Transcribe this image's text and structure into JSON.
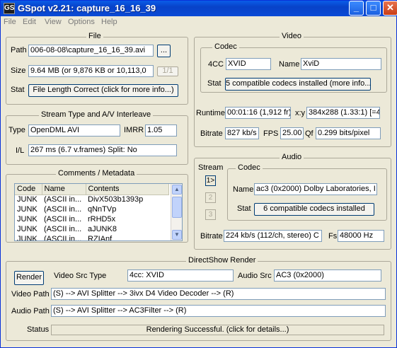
{
  "window": {
    "title": "GSpot v2.21: capture_16_16_39",
    "app_icon": "GS"
  },
  "menu": [
    "File",
    "Edit",
    "View",
    "Options",
    "Help"
  ],
  "file": {
    "group_title": "File",
    "path_label": "Path",
    "path_value": "006-08-08\\capture_16_16_39.avi",
    "browse_label": "...",
    "size_label": "Size",
    "size_value": "9.64 MB (or 9,876 KB or 10,113,0",
    "part_label": "1/1",
    "stat_label": "Stat",
    "stat_value": "File Length Correct (click for more info...)"
  },
  "stream": {
    "group_title": "Stream Type and A/V Interleave",
    "type_label": "Type",
    "type_value": "OpenDML AVI",
    "imrr_label": "IMRR",
    "imrr_value": "1.05",
    "il_label": "I/L",
    "il_value": "267 ms (6.7 v.frames)  Split: No"
  },
  "comments": {
    "group_title": "Comments / Metadata",
    "columns": [
      "Code",
      "Name",
      "Contents"
    ],
    "rows": [
      [
        "JUNK",
        "(ASCII in...",
        "DivX503b1393p"
      ],
      [
        "JUNK",
        "(ASCII in...",
        "qNnTVp"
      ],
      [
        "JUNK",
        "(ASCII in...",
        "rRHD5x"
      ],
      [
        "JUNK",
        "(ASCII in...",
        "aJUNK8"
      ],
      [
        "JUNK",
        "(ASCII in...",
        "RZIAnf"
      ]
    ]
  },
  "video": {
    "group_title": "Video",
    "codec_group": "Codec",
    "fourcc_label": "4CC",
    "fourcc_value": "XVID",
    "name_label": "Name",
    "name_value": "XviD",
    "stat_label": "Stat",
    "stat_value": "5 compatible codecs installed (more info...)",
    "runtime_label": "Runtime",
    "runtime_value": "00:01:16 (1,912 fr)",
    "xy_label": "x:y",
    "xy_value": "384x288 (1.33:1) [=4:",
    "bitrate_label": "Bitrate",
    "bitrate_value": "827 kb/s",
    "fps_label": "FPS",
    "fps_value": "25.00",
    "qf_label": "Qf",
    "qf_value": "0.299 bits/pixel"
  },
  "audio": {
    "group_title": "Audio",
    "stream_label": "Stream",
    "streams": [
      "1>",
      "2",
      "3"
    ],
    "codec_group": "Codec",
    "name_label": "Name",
    "name_value": "ac3 (0x2000) Dolby Laboratories, I",
    "stat_label": "Stat",
    "stat_value": "6 compatible codecs installed",
    "bitrate_label": "Bitrate",
    "bitrate_value": "224 kb/s (112/ch, stereo) C",
    "fs_label": "Fs",
    "fs_value": "48000 Hz"
  },
  "render": {
    "group_title": "DirectShow Render",
    "render_button": "Render",
    "vsrc_label": "Video Src Type",
    "vsrc_value": "4cc: XVID",
    "asrc_label": "Audio Src",
    "asrc_value": "AC3 (0x2000)",
    "vpath_label": "Video Path",
    "vpath_value": "(S) --> AVI Splitter --> 3ivx D4 Video Decoder --> (R)",
    "apath_label": "Audio Path",
    "apath_value": "(S) --> AVI Splitter --> AC3Filter --> (R)",
    "status_label": "Status",
    "status_value": "Rendering Successful.  (click for details...)"
  }
}
